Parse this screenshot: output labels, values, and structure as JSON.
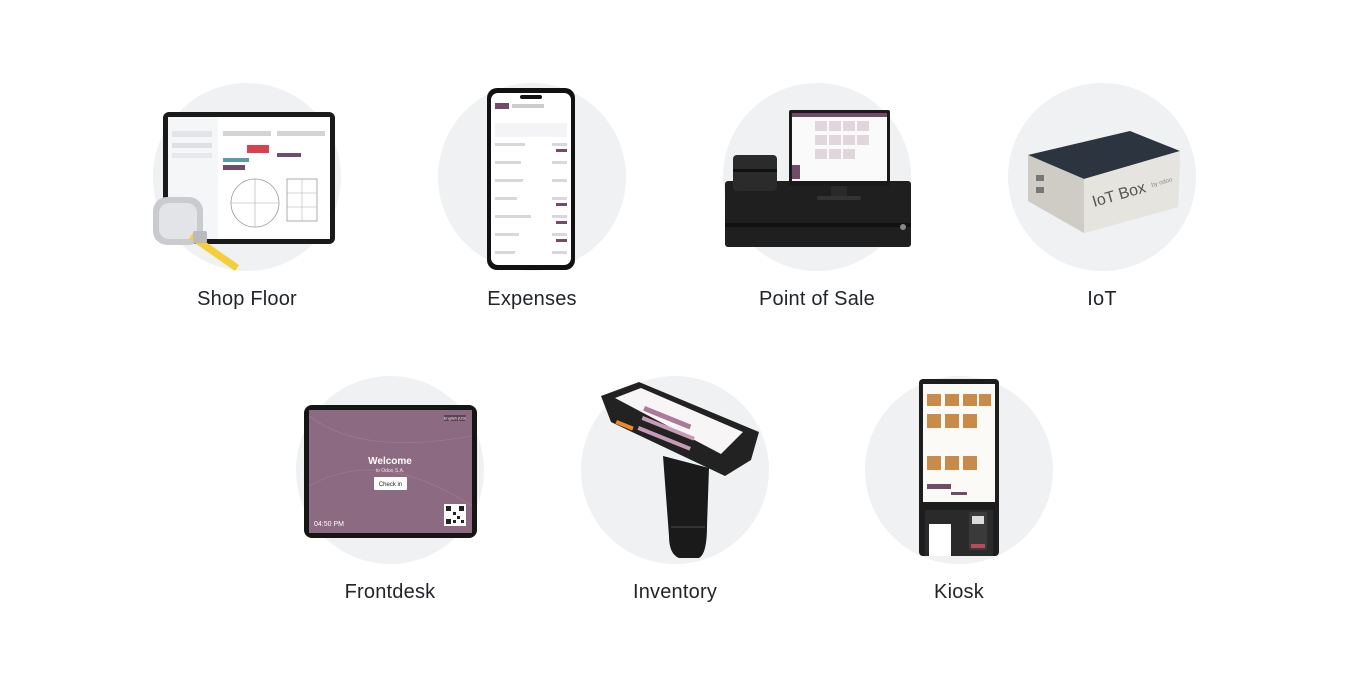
{
  "apps": [
    {
      "key": "shop-floor",
      "label": "Shop Floor",
      "icon": "tablet-tape-measure-icon"
    },
    {
      "key": "expenses",
      "label": "Expenses",
      "icon": "smartphone-expenses-icon"
    },
    {
      "key": "point-of-sale",
      "label": "Point of Sale",
      "icon": "pos-terminal-icon"
    },
    {
      "key": "iot",
      "label": "IoT",
      "icon": "iot-box-icon"
    },
    {
      "key": "frontdesk",
      "label": "Frontdesk",
      "icon": "frontdesk-tablet-icon"
    },
    {
      "key": "inventory",
      "label": "Inventory",
      "icon": "barcode-scanner-icon"
    },
    {
      "key": "kiosk",
      "label": "Kiosk",
      "icon": "self-order-kiosk-icon"
    }
  ],
  "devices": {
    "frontdesk": {
      "welcome": "Welcome",
      "company": "to Odoo S.A.",
      "checkin": "Check in",
      "time": "04:50 PM",
      "lang": "English (US)"
    },
    "iot": {
      "brand": "IoT Box",
      "by": "by odoo"
    }
  },
  "colors": {
    "circle_bg": "#f0f1f3",
    "odoo_purple": "#714b67",
    "frontdesk_bg": "#8c6a82",
    "label_text": "#212529"
  }
}
